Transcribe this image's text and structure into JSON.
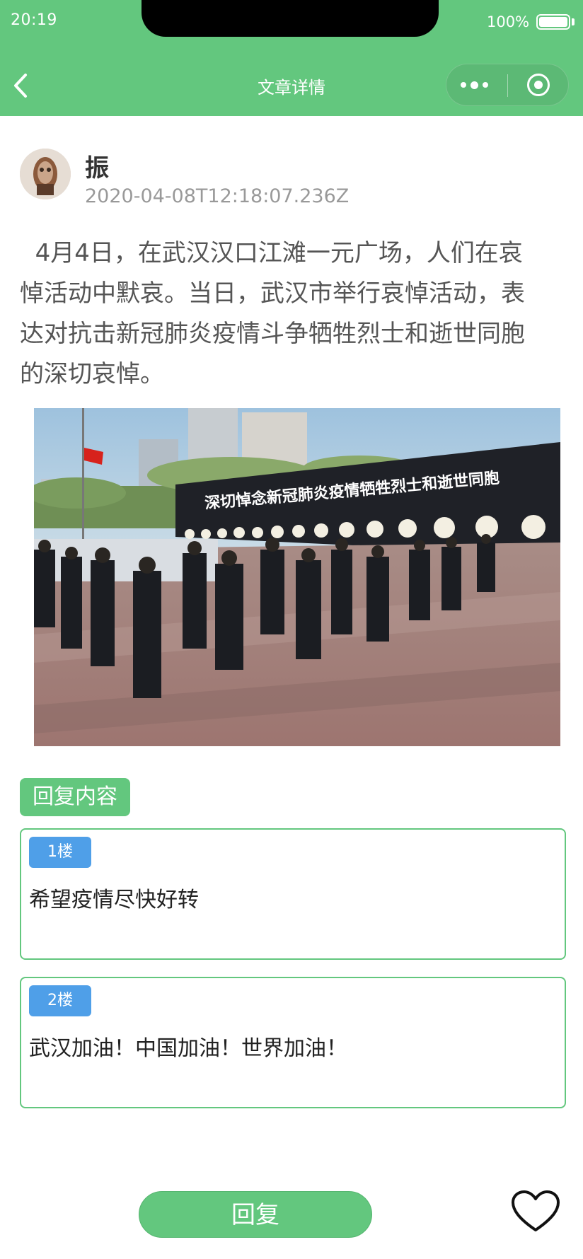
{
  "status_bar": {
    "time": "20:19",
    "battery_level": "100%"
  },
  "nav": {
    "title": "文章详情",
    "back_icon": "chevron-left-icon",
    "more_icon": "more-dots-icon",
    "close_icon": "target-circle-icon"
  },
  "post": {
    "author": "振",
    "avatar_icon": "avatar-image",
    "timestamp": "2020-04-08T12:18:07.236Z",
    "content": "  4月4日，在武汉汉口江滩一元广场，人们在哀悼活动中默哀。当日，武汉市举行哀悼活动，表达对抗击新冠肺炎疫情斗争牺牲烈士和逝世同胞的深切哀悼。",
    "photo_banner": "深切悼念新冠肺炎疫情牺牲烈士和逝世同胞"
  },
  "replies": {
    "section_label": "回复内容",
    "items": [
      {
        "floor": "1楼",
        "text": "希望疫情尽快好转"
      },
      {
        "floor": "2楼",
        "text": "武汉加油！中国加油！世界加油！"
      }
    ]
  },
  "bottom_bar": {
    "reply_label": "回复",
    "favorite_icon": "heart-outline-icon"
  },
  "colors": {
    "brand_green": "#63c77e",
    "floor_badge_blue": "#4f9fe8",
    "muted_text": "#999999"
  }
}
